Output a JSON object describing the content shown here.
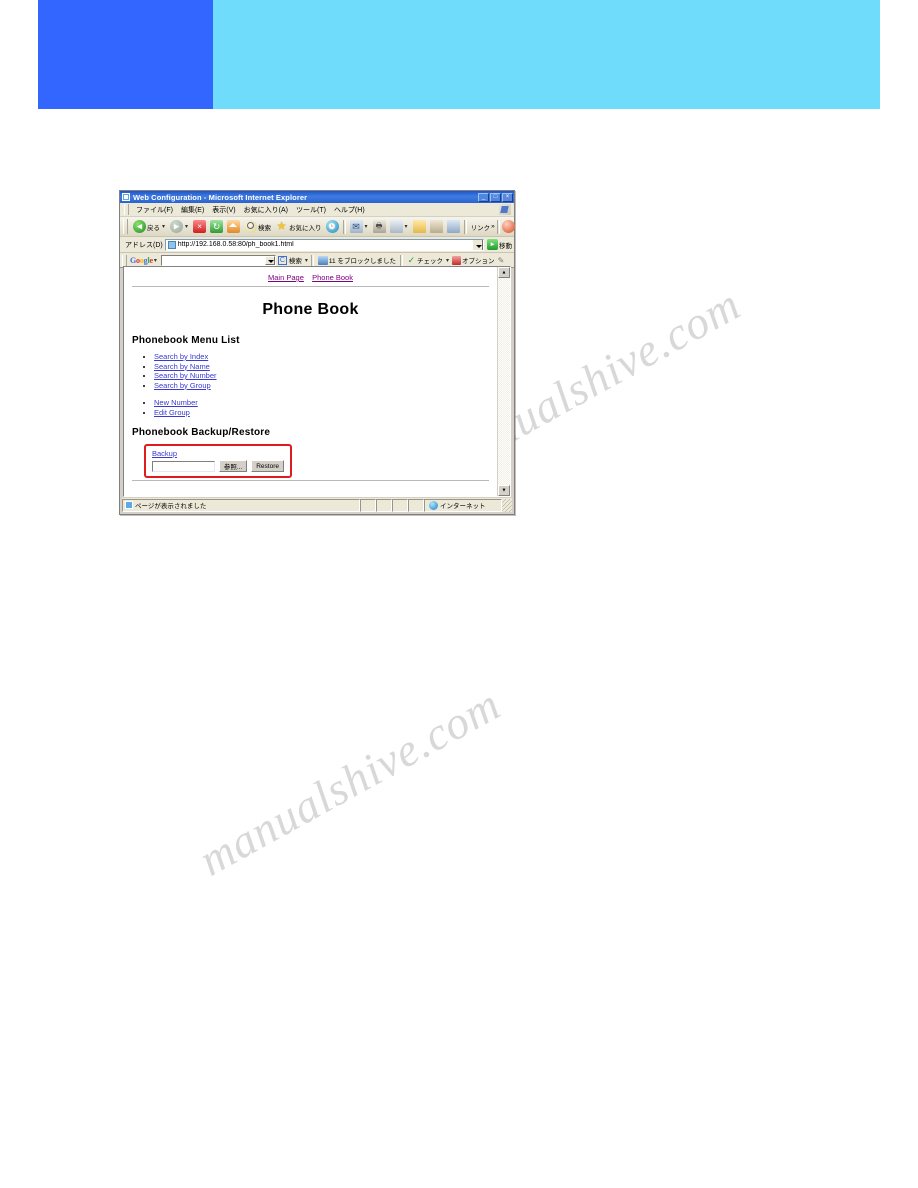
{
  "banner": {
    "left_color": "#3366ff",
    "right_color": "#6fdcfb"
  },
  "watermark": {
    "line1": "manualshive.com",
    "line2": "manualshive.com"
  },
  "browser": {
    "title": "Web Configuration - Microsoft Internet Explorer",
    "window_buttons": {
      "minimize": "_",
      "maximize": "□",
      "close": "×"
    },
    "menu": [
      "ファイル(F)",
      "編集(E)",
      "表示(V)",
      "お気に入り(A)",
      "ツール(T)",
      "ヘルプ(H)"
    ],
    "toolbar": {
      "back_label": "戻る",
      "search_label": "検索",
      "favorites_label": "お気に入り",
      "links_label": "リンク",
      "links_overflow": "»",
      "caret": "▾"
    },
    "address": {
      "label": "アドレス(D)",
      "url": "http://192.168.0.58:80/ph_book1.html",
      "go_label": "移動"
    },
    "google_toolbar": {
      "logo": [
        "G",
        "o",
        "o",
        "g",
        "l",
        "e"
      ],
      "caret": "▾",
      "search_value": "",
      "c_badge": "C",
      "search_label": "検索",
      "blocked_label": "11 をブロックしました",
      "check_label": "チェック",
      "options_label": "オプション"
    },
    "statusbar": {
      "message": "ページが表示されました",
      "zone": "インターネット"
    },
    "scrollbar": {
      "up": "▲",
      "down": "▼"
    }
  },
  "page": {
    "nav_links": [
      "Main Page",
      "Phone Book"
    ],
    "title": "Phone Book",
    "menu_section": {
      "heading": "Phonebook Menu List",
      "items_group1": [
        "Search by Index",
        "Search by Name",
        "Search by Number",
        "Search by Group"
      ],
      "items_group2": [
        "New Number",
        "Edit Group"
      ]
    },
    "backup_section": {
      "heading": "Phonebook Backup/Restore",
      "backup_link": "Backup",
      "file_value": "",
      "browse_label": "参照...",
      "restore_label": "Restore",
      "highlight_color": "#e01b1b"
    }
  }
}
